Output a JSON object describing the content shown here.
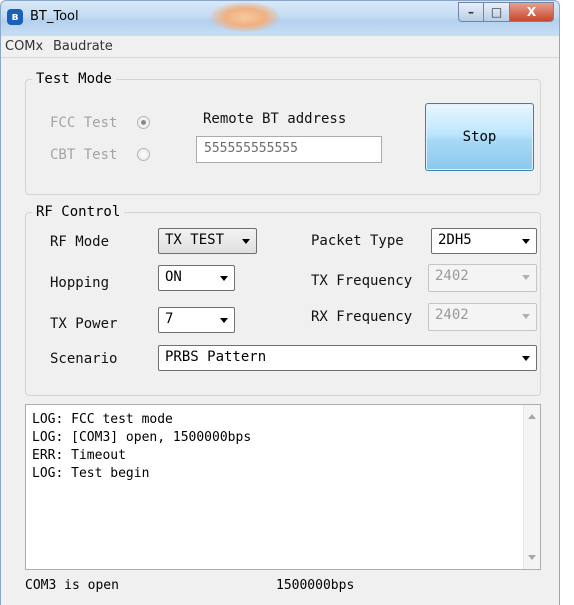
{
  "window": {
    "title": "BT_Tool",
    "app_icon": "bluetooth-icon",
    "controls": {
      "minimize": "–",
      "maximize": "□",
      "close": "X"
    }
  },
  "menu": {
    "items": [
      "COMx",
      "Baudrate"
    ]
  },
  "test_mode": {
    "title": "Test Mode",
    "fcc_label": "FCC Test",
    "fcc_selected": true,
    "cbt_label": "CBT Test",
    "cbt_selected": false,
    "remote_label": "Remote BT address",
    "remote_value": "555555555555",
    "action_button": "Stop"
  },
  "rf_control": {
    "title": "RF Control",
    "rf_mode_label": "RF Mode",
    "rf_mode_value": "TX TEST",
    "packet_type_label": "Packet Type",
    "packet_type_value": "2DH5",
    "hopping_label": "Hopping",
    "hopping_value": "ON",
    "tx_frequency_label": "TX Frequency",
    "tx_frequency_value": "2402",
    "tx_power_label": "TX Power",
    "tx_power_value": "7",
    "rx_frequency_label": "RX Frequency",
    "rx_frequency_value": "2402",
    "scenario_label": "Scenario",
    "scenario_value": "PRBS Pattern"
  },
  "log": {
    "lines": [
      "LOG: FCC test mode",
      "LOG: [COM3] open, 1500000bps",
      "ERR: Timeout",
      "LOG: Test begin"
    ]
  },
  "status_bar": {
    "port_status": "COM3 is open",
    "baudrate": "1500000bps"
  },
  "colors": {
    "title_bar": "#c3dbf3",
    "window_bg": "#f0f0f0",
    "close_button": "#c9462c",
    "stop_button": "#a7d9f5"
  }
}
